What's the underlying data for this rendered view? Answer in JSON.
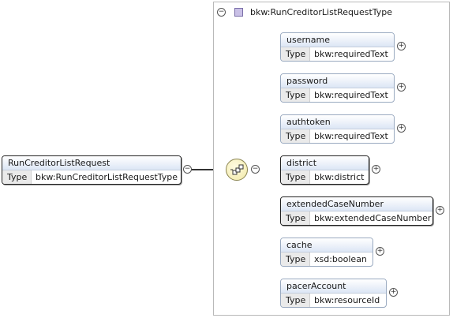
{
  "root": {
    "name": "RunCreditorListRequest",
    "type_label": "Type",
    "type_value": "bkw:RunCreditorListRequestType"
  },
  "complex_type": {
    "name": "bkw:RunCreditorListRequestType",
    "collapse_glyph": "−"
  },
  "compositor": {
    "kind": "sequence",
    "icon": "sequence-icon"
  },
  "elements": [
    {
      "name": "username",
      "type_label": "Type",
      "type_value": "bkw:requiredText",
      "required": false
    },
    {
      "name": "password",
      "type_label": "Type",
      "type_value": "bkw:requiredText",
      "required": false
    },
    {
      "name": "authtoken",
      "type_label": "Type",
      "type_value": "bkw:requiredText",
      "required": false
    },
    {
      "name": "district",
      "type_label": "Type",
      "type_value": "bkw:district",
      "required": true
    },
    {
      "name": "extendedCaseNumber",
      "type_label": "Type",
      "type_value": "bkw:extendedCaseNumber",
      "required": true
    },
    {
      "name": "cache",
      "type_label": "Type",
      "type_value": "xsd:boolean",
      "required": false
    },
    {
      "name": "pacerAccount",
      "type_label": "Type",
      "type_value": "bkw:resourceId",
      "required": false
    }
  ],
  "glyphs": {
    "expand": "+",
    "collapse": "−"
  },
  "colors": {
    "type_swatch": "#c9c0e6",
    "element_header": "#dce6f5",
    "sequence_fill": "#f1e9a8"
  }
}
